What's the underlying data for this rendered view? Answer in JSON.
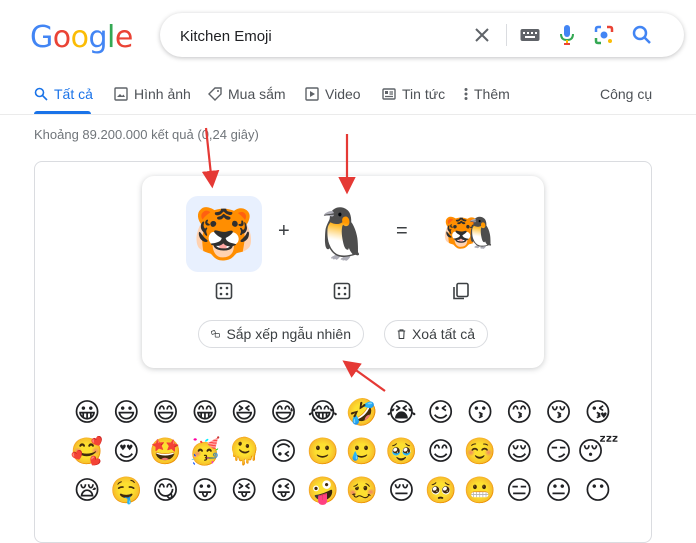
{
  "logo": {
    "letters": [
      "G",
      "o",
      "o",
      "g",
      "l",
      "e"
    ],
    "colors": [
      "#4285f4",
      "#ea4335",
      "#fbbc05",
      "#4285f4",
      "#34a853",
      "#ea4335"
    ]
  },
  "search": {
    "value": "Kitchen Emoji",
    "icons": [
      "close-icon",
      "keyboard-icon",
      "microphone-icon",
      "google-lens-icon",
      "search-icon"
    ]
  },
  "tabs": [
    {
      "label": "Tất cả",
      "icon": "search-icon",
      "active": true
    },
    {
      "label": "Hình ảnh",
      "icon": "image-icon"
    },
    {
      "label": "Mua sắm",
      "icon": "tag-icon"
    },
    {
      "label": "Video",
      "icon": "play-icon"
    },
    {
      "label": "Tin tức",
      "icon": "news-icon"
    },
    {
      "label": "Thêm",
      "icon": "more-vert-icon"
    }
  ],
  "tools_label": "Công cụ",
  "result_stats": "Khoảng 89.200.000 kết quả (0,24 giây)",
  "kitchen": {
    "left_emoji": "🐯",
    "plus": "+",
    "right_emoji": "🐧",
    "equals": "=",
    "result_emoji": "🐯🐧",
    "randomize_label": "Sắp xếp ngẫu nhiên",
    "clear_label": "Xoá tất cả"
  },
  "emoji_rows": [
    [
      "😀",
      "😃",
      "😄",
      "😁",
      "😆",
      "😅",
      "😂",
      "🤣",
      "😭",
      "😉",
      "😗",
      "😙",
      "😚",
      "😘"
    ],
    [
      "🥰",
      "😍",
      "🤩",
      "🥳",
      "🫠",
      "🙃",
      "🙂",
      "🥲",
      "🥹",
      "😊",
      "☺️",
      "😌",
      "😏",
      "😴"
    ],
    [
      "😪",
      "🤤",
      "😋",
      "😛",
      "😝",
      "😜",
      "🤪",
      "🥴",
      "😔",
      "🥺",
      "😬",
      "😑",
      "😐",
      "😶"
    ]
  ],
  "accent_color": "#1a73e8",
  "annotation_color": "#e53935"
}
